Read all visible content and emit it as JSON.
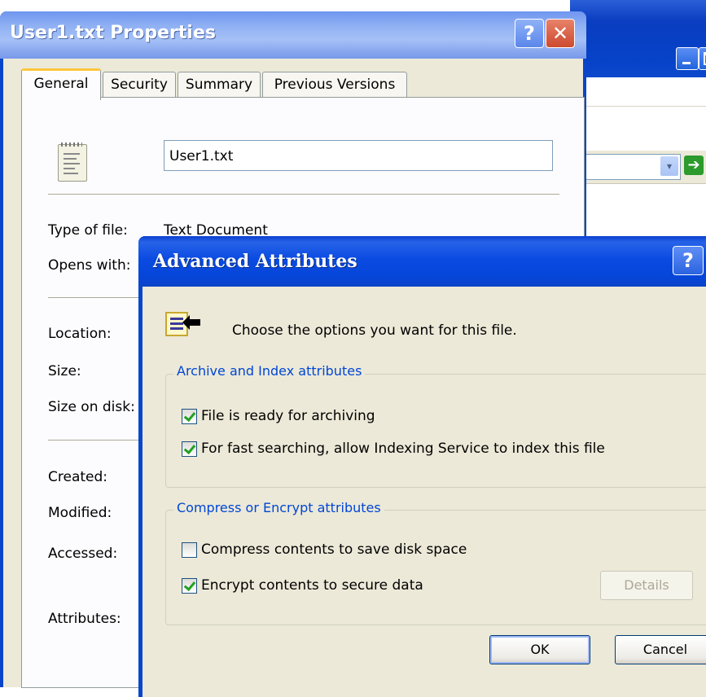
{
  "properties_dialog": {
    "title": "User1.txt Properties",
    "tabs": [
      {
        "label": "General",
        "active": true
      },
      {
        "label": "Security",
        "active": false
      },
      {
        "label": "Summary",
        "active": false
      },
      {
        "label": "Previous Versions",
        "active": false
      }
    ],
    "file_name": "User1.txt",
    "rows": {
      "type_of_file_label": "Type of file:",
      "type_of_file_value": "Text Document",
      "opens_with_label": "Opens with:",
      "location_label": "Location:",
      "size_label": "Size:",
      "size_on_disk_label": "Size on disk:",
      "created_label": "Created:",
      "modified_label": "Modified:",
      "accessed_label": "Accessed:",
      "attributes_label": "Attributes:"
    },
    "help_glyph": "?",
    "close_glyph": "✕"
  },
  "advanced_dialog": {
    "title": "Advanced Attributes",
    "help_glyph": "?",
    "intro_text": "Choose the options you want for this file.",
    "archive_group": {
      "label": "Archive and Index attributes",
      "options": [
        {
          "label": "File is ready for archiving",
          "checked": true
        },
        {
          "label": "For fast searching, allow Indexing Service to index this file",
          "checked": true
        }
      ]
    },
    "compress_group": {
      "label": "Compress or Encrypt attributes",
      "options": [
        {
          "label": "Compress contents to save disk space",
          "checked": false
        },
        {
          "label": "Encrypt contents to secure data",
          "checked": true
        }
      ],
      "details_button": "Details"
    },
    "ok_button": "OK",
    "cancel_button": "Cancel"
  },
  "background_window": {
    "go_glyph": "➔",
    "dropdown_glyph": "▾"
  },
  "colors": {
    "accent_blue": "#0a46cc",
    "group_label_blue": "#0046d5",
    "check_green": "#21a121",
    "close_red": "#cc4a2f",
    "active_tab_highlight": "#ffc73c"
  }
}
